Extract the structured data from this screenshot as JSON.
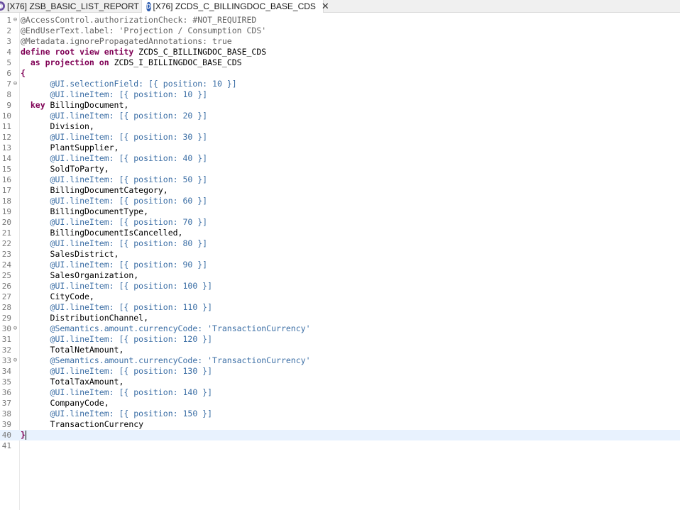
{
  "tabs": [
    {
      "label": "[X76] ZSB_BASIC_LIST_REPORT",
      "icon": "cds-view-icon",
      "active": false
    },
    {
      "label": "[X76] ZCDS_C_BILLINGDOC_BASE_CDS",
      "icon": "cds-ddl-icon",
      "active": true,
      "close": "✕"
    }
  ],
  "lines": [
    {
      "n": "1",
      "fold": "⊖",
      "segs": [
        [
          "anno",
          "@AccessControl.authorizationCheck: #NOT_REQUIRED"
        ]
      ]
    },
    {
      "n": "2",
      "fold": "",
      "segs": [
        [
          "anno",
          "@EndUserText.label: 'Projection / Consumption CDS'"
        ]
      ]
    },
    {
      "n": "3",
      "fold": "",
      "segs": [
        [
          "anno",
          "@Metadata.ignorePropagatedAnnotations: true"
        ]
      ]
    },
    {
      "n": "4",
      "fold": "",
      "segs": [
        [
          "kw",
          "define root view entity "
        ],
        [
          "id",
          "ZCDS_C_BILLINGDOC_BASE_CDS"
        ]
      ]
    },
    {
      "n": "5",
      "fold": "",
      "segs": [
        [
          "kw",
          "  as projection on "
        ],
        [
          "id",
          "ZCDS_I_BILLINGDOC_BASE_CDS"
        ]
      ]
    },
    {
      "n": "6",
      "fold": "",
      "segs": [
        [
          "kw",
          "{"
        ]
      ]
    },
    {
      "n": "7",
      "fold": "⊖",
      "segs": [
        [
          "annoblue",
          "      @UI.selectionField: [{ position: 10 }]"
        ]
      ]
    },
    {
      "n": "8",
      "fold": "",
      "segs": [
        [
          "annoblue",
          "      @UI.lineItem: [{ position: 10 }]"
        ]
      ]
    },
    {
      "n": "9",
      "fold": "",
      "segs": [
        [
          "kw",
          "  key "
        ],
        [
          "id",
          "BillingDocument,"
        ]
      ]
    },
    {
      "n": "10",
      "fold": "",
      "segs": [
        [
          "annoblue",
          "      @UI.lineItem: [{ position: 20 }]"
        ]
      ]
    },
    {
      "n": "11",
      "fold": "",
      "segs": [
        [
          "id",
          "      Division,"
        ]
      ]
    },
    {
      "n": "12",
      "fold": "",
      "segs": [
        [
          "annoblue",
          "      @UI.lineItem: [{ position: 30 }]"
        ]
      ]
    },
    {
      "n": "13",
      "fold": "",
      "segs": [
        [
          "id",
          "      PlantSupplier,"
        ]
      ]
    },
    {
      "n": "14",
      "fold": "",
      "segs": [
        [
          "annoblue",
          "      @UI.lineItem: [{ position: 40 }]"
        ]
      ]
    },
    {
      "n": "15",
      "fold": "",
      "segs": [
        [
          "id",
          "      SoldToParty,"
        ]
      ]
    },
    {
      "n": "16",
      "fold": "",
      "segs": [
        [
          "annoblue",
          "      @UI.lineItem: [{ position: 50 }]"
        ]
      ]
    },
    {
      "n": "17",
      "fold": "",
      "segs": [
        [
          "id",
          "      BillingDocumentCategory,"
        ]
      ]
    },
    {
      "n": "18",
      "fold": "",
      "segs": [
        [
          "annoblue",
          "      @UI.lineItem: [{ position: 60 }]"
        ]
      ]
    },
    {
      "n": "19",
      "fold": "",
      "segs": [
        [
          "id",
          "      BillingDocumentType,"
        ]
      ]
    },
    {
      "n": "20",
      "fold": "",
      "segs": [
        [
          "annoblue",
          "      @UI.lineItem: [{ position: 70 }]"
        ]
      ]
    },
    {
      "n": "21",
      "fold": "",
      "segs": [
        [
          "id",
          "      BillingDocumentIsCancelled,"
        ]
      ]
    },
    {
      "n": "22",
      "fold": "",
      "segs": [
        [
          "annoblue",
          "      @UI.lineItem: [{ position: 80 }]"
        ]
      ]
    },
    {
      "n": "23",
      "fold": "",
      "segs": [
        [
          "id",
          "      SalesDistrict,"
        ]
      ]
    },
    {
      "n": "24",
      "fold": "",
      "segs": [
        [
          "annoblue",
          "      @UI.lineItem: [{ position: 90 }]"
        ]
      ]
    },
    {
      "n": "25",
      "fold": "",
      "segs": [
        [
          "id",
          "      SalesOrganization,"
        ]
      ]
    },
    {
      "n": "26",
      "fold": "",
      "segs": [
        [
          "annoblue",
          "      @UI.lineItem: [{ position: 100 }]"
        ]
      ]
    },
    {
      "n": "27",
      "fold": "",
      "segs": [
        [
          "id",
          "      CityCode,"
        ]
      ]
    },
    {
      "n": "28",
      "fold": "",
      "segs": [
        [
          "annoblue",
          "      @UI.lineItem: [{ position: 110 }]"
        ]
      ]
    },
    {
      "n": "29",
      "fold": "",
      "segs": [
        [
          "id",
          "      DistributionChannel,"
        ]
      ]
    },
    {
      "n": "30",
      "fold": "⊖",
      "segs": [
        [
          "annoblue",
          "      @Semantics.amount.currencyCode: 'TransactionCurrency'"
        ]
      ]
    },
    {
      "n": "31",
      "fold": "",
      "segs": [
        [
          "annoblue",
          "      @UI.lineItem: [{ position: 120 }]"
        ]
      ]
    },
    {
      "n": "32",
      "fold": "",
      "segs": [
        [
          "id",
          "      TotalNetAmount,"
        ]
      ]
    },
    {
      "n": "33",
      "fold": "⊖",
      "segs": [
        [
          "annoblue",
          "      @Semantics.amount.currencyCode: 'TransactionCurrency'"
        ]
      ]
    },
    {
      "n": "34",
      "fold": "",
      "segs": [
        [
          "annoblue",
          "      @UI.lineItem: [{ position: 130 }]"
        ]
      ]
    },
    {
      "n": "35",
      "fold": "",
      "segs": [
        [
          "id",
          "      TotalTaxAmount,"
        ]
      ]
    },
    {
      "n": "36",
      "fold": "",
      "segs": [
        [
          "annoblue",
          "      @UI.lineItem: [{ position: 140 }]"
        ]
      ]
    },
    {
      "n": "37",
      "fold": "",
      "segs": [
        [
          "id",
          "      CompanyCode,"
        ]
      ]
    },
    {
      "n": "38",
      "fold": "",
      "segs": [
        [
          "annoblue",
          "      @UI.lineItem: [{ position: 150 }]"
        ]
      ]
    },
    {
      "n": "39",
      "fold": "",
      "segs": [
        [
          "id",
          "      TransactionCurrency"
        ]
      ]
    },
    {
      "n": "40",
      "fold": "",
      "segs": [
        [
          "kw",
          "}"
        ]
      ],
      "current": true
    },
    {
      "n": "41",
      "fold": "",
      "segs": []
    }
  ]
}
